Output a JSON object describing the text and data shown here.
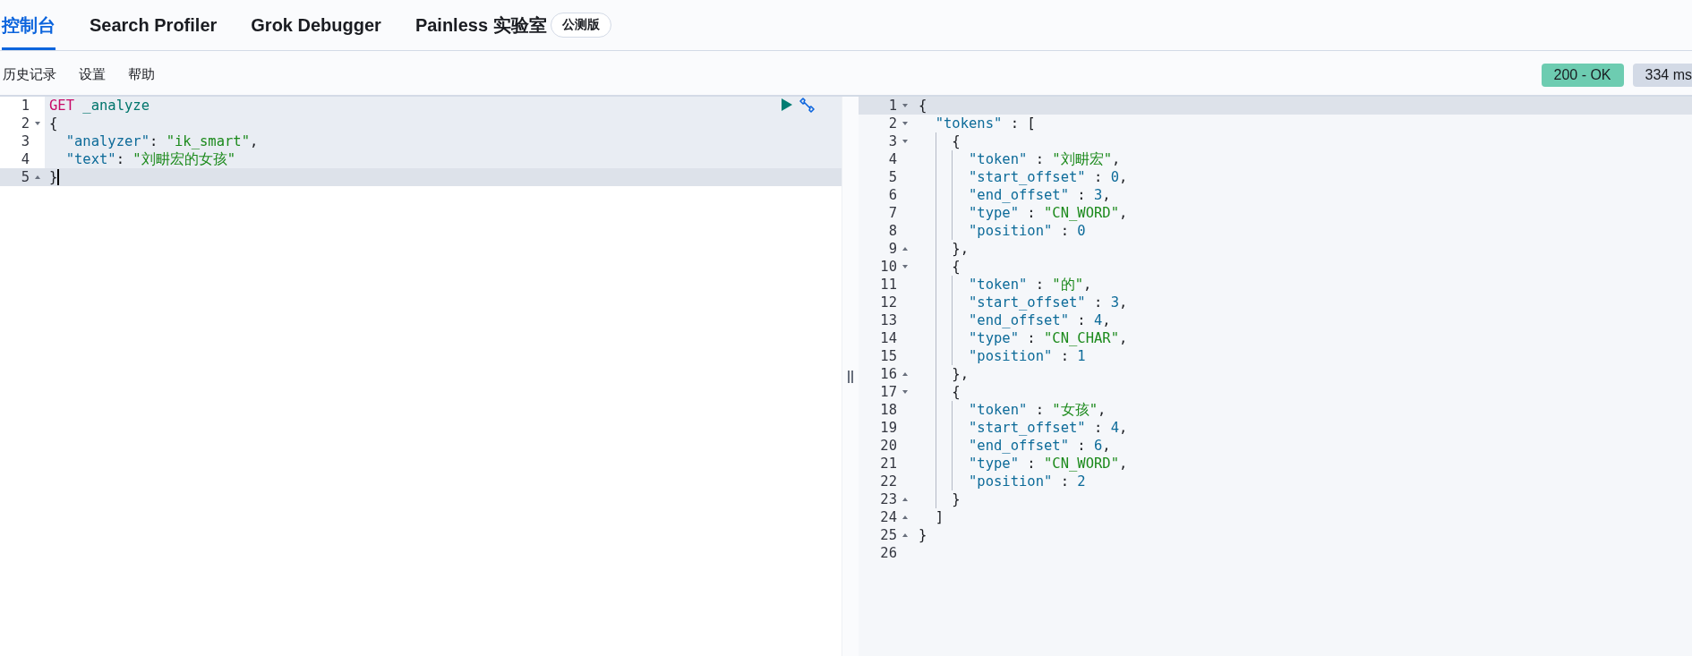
{
  "tabs": [
    {
      "label": "控制台",
      "selected": true
    },
    {
      "label": "Search Profiler",
      "selected": false
    },
    {
      "label": "Grok Debugger",
      "selected": false
    },
    {
      "label": "Painless 实验室",
      "selected": false,
      "badge": "公测版"
    }
  ],
  "toolbar": {
    "items": [
      "历史记录",
      "设置",
      "帮助"
    ],
    "badges": [
      {
        "kind": "status",
        "text": "200 - OK"
      },
      {
        "kind": "time",
        "text": "334 ms"
      }
    ]
  },
  "request": {
    "lines": [
      {
        "number": "1",
        "kind": "plain",
        "active": false,
        "segments": [
          {
            "kind": "method",
            "text": "GET"
          },
          {
            "kind": "url",
            "text": " _analyze"
          }
        ]
      },
      {
        "number": "2",
        "kind": "fold-start",
        "active": false,
        "segments": [
          {
            "kind": "punct",
            "text": "{"
          }
        ]
      },
      {
        "number": "3",
        "kind": "plain",
        "active": false,
        "segments": [
          {
            "kind": "key",
            "text": "  \"analyzer\""
          },
          {
            "kind": "punct",
            "text": ": "
          },
          {
            "kind": "string",
            "text": "\"ik_smart\""
          },
          {
            "kind": "punct",
            "text": ","
          }
        ]
      },
      {
        "number": "4",
        "kind": "plain",
        "active": false,
        "segments": [
          {
            "kind": "key",
            "text": "  \"text\""
          },
          {
            "kind": "punct",
            "text": ": "
          },
          {
            "kind": "string",
            "text": "\"刘畊宏的女孩\""
          }
        ]
      },
      {
        "number": "5",
        "kind": "fold-end",
        "active": true,
        "segments": [
          {
            "kind": "punct",
            "text": "}"
          }
        ]
      }
    ]
  },
  "response": {
    "lines": [
      {
        "number": "1",
        "kind": "fold-start",
        "active": true,
        "segments": [
          {
            "kind": "punct",
            "text": "{"
          }
        ]
      },
      {
        "number": "2",
        "kind": "fold-start",
        "active": false,
        "segments": [
          {
            "kind": "key",
            "text": "  \"tokens\""
          },
          {
            "kind": "punct",
            "text": " : ["
          }
        ]
      },
      {
        "number": "3",
        "kind": "fold-start",
        "active": false,
        "segments": [
          {
            "kind": "punct",
            "text": "    {"
          }
        ]
      },
      {
        "number": "4",
        "kind": "plain",
        "active": false,
        "segments": [
          {
            "kind": "key",
            "text": "      \"token\""
          },
          {
            "kind": "punct",
            "text": " : "
          },
          {
            "kind": "string",
            "text": "\"刘畊宏\""
          },
          {
            "kind": "punct",
            "text": ","
          }
        ]
      },
      {
        "number": "5",
        "kind": "plain",
        "active": false,
        "segments": [
          {
            "kind": "key",
            "text": "      \"start_offset\""
          },
          {
            "kind": "punct",
            "text": " : "
          },
          {
            "kind": "number",
            "text": "0"
          },
          {
            "kind": "punct",
            "text": ","
          }
        ]
      },
      {
        "number": "6",
        "kind": "plain",
        "active": false,
        "segments": [
          {
            "kind": "key",
            "text": "      \"end_offset\""
          },
          {
            "kind": "punct",
            "text": " : "
          },
          {
            "kind": "number",
            "text": "3"
          },
          {
            "kind": "punct",
            "text": ","
          }
        ]
      },
      {
        "number": "7",
        "kind": "plain",
        "active": false,
        "segments": [
          {
            "kind": "key",
            "text": "      \"type\""
          },
          {
            "kind": "punct",
            "text": " : "
          },
          {
            "kind": "string",
            "text": "\"CN_WORD\""
          },
          {
            "kind": "punct",
            "text": ","
          }
        ]
      },
      {
        "number": "8",
        "kind": "plain",
        "active": false,
        "segments": [
          {
            "kind": "key",
            "text": "      \"position\""
          },
          {
            "kind": "punct",
            "text": " : "
          },
          {
            "kind": "number",
            "text": "0"
          }
        ]
      },
      {
        "number": "9",
        "kind": "fold-end",
        "active": false,
        "segments": [
          {
            "kind": "punct",
            "text": "    },"
          }
        ]
      },
      {
        "number": "10",
        "kind": "fold-start",
        "active": false,
        "segments": [
          {
            "kind": "punct",
            "text": "    {"
          }
        ]
      },
      {
        "number": "11",
        "kind": "plain",
        "active": false,
        "segments": [
          {
            "kind": "key",
            "text": "      \"token\""
          },
          {
            "kind": "punct",
            "text": " : "
          },
          {
            "kind": "string",
            "text": "\"的\""
          },
          {
            "kind": "punct",
            "text": ","
          }
        ]
      },
      {
        "number": "12",
        "kind": "plain",
        "active": false,
        "segments": [
          {
            "kind": "key",
            "text": "      \"start_offset\""
          },
          {
            "kind": "punct",
            "text": " : "
          },
          {
            "kind": "number",
            "text": "3"
          },
          {
            "kind": "punct",
            "text": ","
          }
        ]
      },
      {
        "number": "13",
        "kind": "plain",
        "active": false,
        "segments": [
          {
            "kind": "key",
            "text": "      \"end_offset\""
          },
          {
            "kind": "punct",
            "text": " : "
          },
          {
            "kind": "number",
            "text": "4"
          },
          {
            "kind": "punct",
            "text": ","
          }
        ]
      },
      {
        "number": "14",
        "kind": "plain",
        "active": false,
        "segments": [
          {
            "kind": "key",
            "text": "      \"type\""
          },
          {
            "kind": "punct",
            "text": " : "
          },
          {
            "kind": "string",
            "text": "\"CN_CHAR\""
          },
          {
            "kind": "punct",
            "text": ","
          }
        ]
      },
      {
        "number": "15",
        "kind": "plain",
        "active": false,
        "segments": [
          {
            "kind": "key",
            "text": "      \"position\""
          },
          {
            "kind": "punct",
            "text": " : "
          },
          {
            "kind": "number",
            "text": "1"
          }
        ]
      },
      {
        "number": "16",
        "kind": "fold-end",
        "active": false,
        "segments": [
          {
            "kind": "punct",
            "text": "    },"
          }
        ]
      },
      {
        "number": "17",
        "kind": "fold-start",
        "active": false,
        "segments": [
          {
            "kind": "punct",
            "text": "    {"
          }
        ]
      },
      {
        "number": "18",
        "kind": "plain",
        "active": false,
        "segments": [
          {
            "kind": "key",
            "text": "      \"token\""
          },
          {
            "kind": "punct",
            "text": " : "
          },
          {
            "kind": "string",
            "text": "\"女孩\""
          },
          {
            "kind": "punct",
            "text": ","
          }
        ]
      },
      {
        "number": "19",
        "kind": "plain",
        "active": false,
        "segments": [
          {
            "kind": "key",
            "text": "      \"start_offset\""
          },
          {
            "kind": "punct",
            "text": " : "
          },
          {
            "kind": "number",
            "text": "4"
          },
          {
            "kind": "punct",
            "text": ","
          }
        ]
      },
      {
        "number": "20",
        "kind": "plain",
        "active": false,
        "segments": [
          {
            "kind": "key",
            "text": "      \"end_offset\""
          },
          {
            "kind": "punct",
            "text": " : "
          },
          {
            "kind": "number",
            "text": "6"
          },
          {
            "kind": "punct",
            "text": ","
          }
        ]
      },
      {
        "number": "21",
        "kind": "plain",
        "active": false,
        "segments": [
          {
            "kind": "key",
            "text": "      \"type\""
          },
          {
            "kind": "punct",
            "text": " : "
          },
          {
            "kind": "string",
            "text": "\"CN_WORD\""
          },
          {
            "kind": "punct",
            "text": ","
          }
        ]
      },
      {
        "number": "22",
        "kind": "plain",
        "active": false,
        "segments": [
          {
            "kind": "key",
            "text": "      \"position\""
          },
          {
            "kind": "punct",
            "text": " : "
          },
          {
            "kind": "number",
            "text": "2"
          }
        ]
      },
      {
        "number": "23",
        "kind": "fold-end",
        "active": false,
        "segments": [
          {
            "kind": "punct",
            "text": "    }"
          }
        ]
      },
      {
        "number": "24",
        "kind": "fold-end",
        "active": false,
        "segments": [
          {
            "kind": "punct",
            "text": "  ]"
          }
        ]
      },
      {
        "number": "25",
        "kind": "fold-end",
        "active": false,
        "segments": [
          {
            "kind": "punct",
            "text": "}"
          }
        ]
      },
      {
        "number": "26",
        "kind": "plain",
        "active": false
      }
    ]
  }
}
